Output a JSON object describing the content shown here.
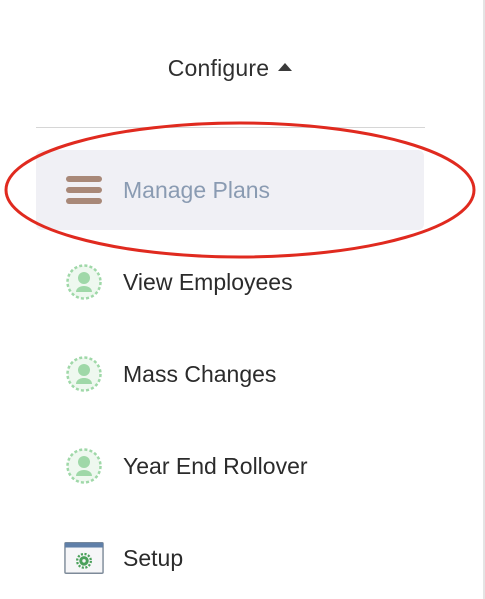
{
  "header": {
    "title": "Configure",
    "caret_icon": "caret-up-icon"
  },
  "menu": {
    "items": [
      {
        "label": "Manage Plans",
        "icon": "list-icon",
        "active": true
      },
      {
        "label": "View Employees",
        "icon": "person-icon",
        "active": false
      },
      {
        "label": "Mass Changes",
        "icon": "person-icon",
        "active": false
      },
      {
        "label": "Year End Rollover",
        "icon": "person-icon",
        "active": false
      },
      {
        "label": "Setup",
        "icon": "settings-window-icon",
        "active": false
      }
    ]
  },
  "colors": {
    "active_background": "#f0f0f5",
    "active_label": "#8a9bb2",
    "annotation_ring": "#e02a1f",
    "person_icon_fill": "#9fd8a8",
    "list_icon": "#9b7b6b"
  }
}
